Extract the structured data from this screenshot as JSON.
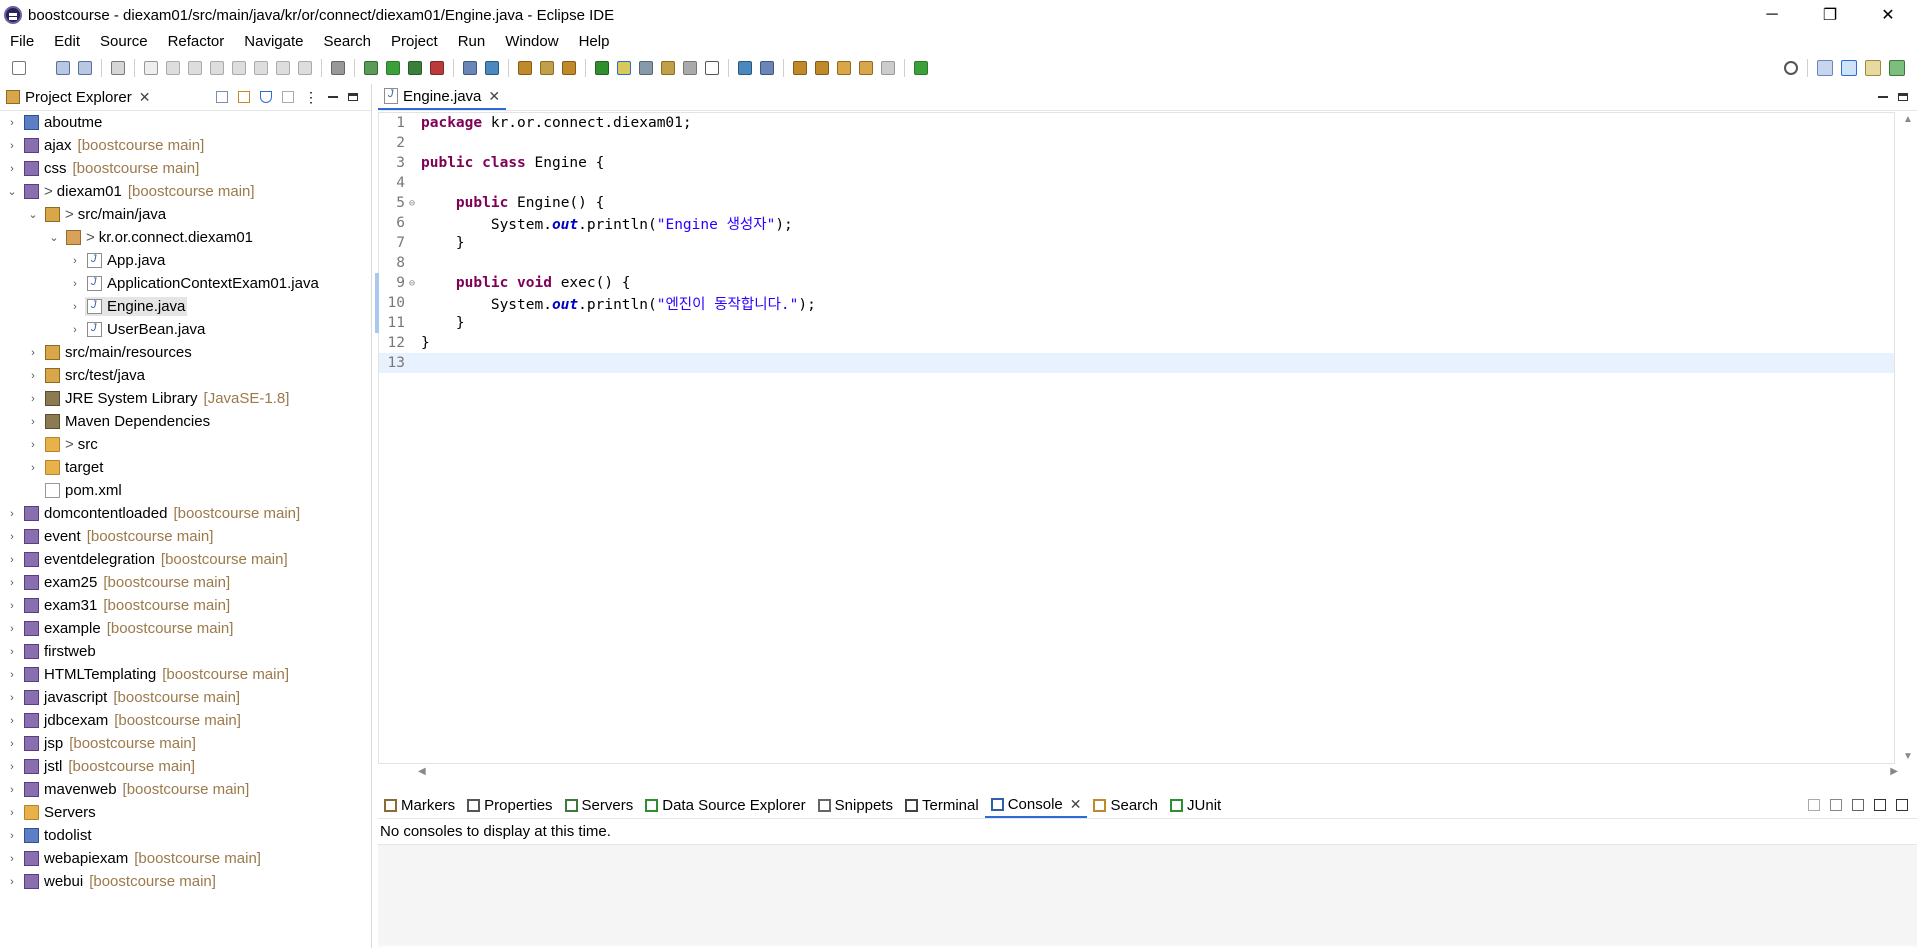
{
  "window": {
    "title": "boostcourse - diexam01/src/main/java/kr/or/connect/diexam01/Engine.java - Eclipse IDE",
    "minimize": "─",
    "restore": "❐",
    "close": "✕"
  },
  "menu": [
    "File",
    "Edit",
    "Source",
    "Refactor",
    "Navigate",
    "Search",
    "Project",
    "Run",
    "Window",
    "Help"
  ],
  "project_explorer": {
    "tab_label": "Project Explorer",
    "close_glyph": "✕",
    "tree": [
      {
        "name": "aboutme",
        "deco": "",
        "twisty": "›",
        "icon": "project",
        "indent": 0
      },
      {
        "name": "ajax",
        "deco": "[boostcourse main]",
        "twisty": "›",
        "icon": "webproj",
        "indent": 0
      },
      {
        "name": "css",
        "deco": "[boostcourse main]",
        "twisty": "›",
        "icon": "webproj",
        "indent": 0
      },
      {
        "name": "diexam01",
        "deco": "[boostcourse main]",
        "twisty": "⌄",
        "icon": "webproj",
        "indent": 0,
        "git": ">"
      },
      {
        "name": "src/main/java",
        "deco": "",
        "twisty": "⌄",
        "icon": "srcfolder",
        "indent": 1,
        "git": ">"
      },
      {
        "name": "kr.or.connect.diexam01",
        "deco": "",
        "twisty": "⌄",
        "icon": "package",
        "indent": 2,
        "git": ">"
      },
      {
        "name": "App.java",
        "deco": "",
        "twisty": "›",
        "icon": "java",
        "indent": 3
      },
      {
        "name": "ApplicationContextExam01.java",
        "deco": "",
        "twisty": "›",
        "icon": "java",
        "indent": 3
      },
      {
        "name": "Engine.java",
        "deco": "",
        "twisty": "›",
        "icon": "java",
        "indent": 3,
        "selected": true
      },
      {
        "name": "UserBean.java",
        "deco": "",
        "twisty": "›",
        "icon": "java",
        "indent": 3
      },
      {
        "name": "src/main/resources",
        "deco": "",
        "twisty": "›",
        "icon": "srcfolder",
        "indent": 1
      },
      {
        "name": "src/test/java",
        "deco": "",
        "twisty": "›",
        "icon": "srcfolder",
        "indent": 1
      },
      {
        "name": "JRE System Library",
        "deco": "[JavaSE-1.8]",
        "twisty": "›",
        "icon": "lib",
        "indent": 1
      },
      {
        "name": "Maven Dependencies",
        "deco": "",
        "twisty": "›",
        "icon": "lib",
        "indent": 1
      },
      {
        "name": "src",
        "deco": "",
        "twisty": "›",
        "icon": "folder",
        "indent": 1,
        "git": ">"
      },
      {
        "name": "target",
        "deco": "",
        "twisty": "›",
        "icon": "folder",
        "indent": 1
      },
      {
        "name": "pom.xml",
        "deco": "",
        "twisty": "",
        "icon": "xml",
        "indent": 1
      },
      {
        "name": "domcontentloaded",
        "deco": "[boostcourse main]",
        "twisty": "›",
        "icon": "webproj",
        "indent": 0
      },
      {
        "name": "event",
        "deco": "[boostcourse main]",
        "twisty": "›",
        "icon": "webproj",
        "indent": 0
      },
      {
        "name": "eventdelegration",
        "deco": "[boostcourse main]",
        "twisty": "›",
        "icon": "webproj",
        "indent": 0
      },
      {
        "name": "exam25",
        "deco": "[boostcourse main]",
        "twisty": "›",
        "icon": "webproj",
        "indent": 0
      },
      {
        "name": "exam31",
        "deco": "[boostcourse main]",
        "twisty": "›",
        "icon": "webproj",
        "indent": 0
      },
      {
        "name": "example",
        "deco": "[boostcourse main]",
        "twisty": "›",
        "icon": "webproj",
        "indent": 0
      },
      {
        "name": "firstweb",
        "deco": "",
        "twisty": "›",
        "icon": "webproj",
        "indent": 0
      },
      {
        "name": "HTMLTemplating",
        "deco": "[boostcourse main]",
        "twisty": "›",
        "icon": "webproj",
        "indent": 0
      },
      {
        "name": "javascript",
        "deco": "[boostcourse main]",
        "twisty": "›",
        "icon": "webproj",
        "indent": 0
      },
      {
        "name": "jdbcexam",
        "deco": "[boostcourse main]",
        "twisty": "›",
        "icon": "webproj",
        "indent": 0
      },
      {
        "name": "jsp",
        "deco": "[boostcourse main]",
        "twisty": "›",
        "icon": "webproj",
        "indent": 0
      },
      {
        "name": "jstl",
        "deco": "[boostcourse main]",
        "twisty": "›",
        "icon": "webproj",
        "indent": 0
      },
      {
        "name": "mavenweb",
        "deco": "[boostcourse main]",
        "twisty": "›",
        "icon": "webproj",
        "indent": 0
      },
      {
        "name": "Servers",
        "deco": "",
        "twisty": "›",
        "icon": "folder",
        "indent": 0
      },
      {
        "name": "todolist",
        "deco": "",
        "twisty": "›",
        "icon": "project",
        "indent": 0
      },
      {
        "name": "webapiexam",
        "deco": "[boostcourse main]",
        "twisty": "›",
        "icon": "webproj",
        "indent": 0
      },
      {
        "name": "webui",
        "deco": "[boostcourse main]",
        "twisty": "›",
        "icon": "webproj",
        "indent": 0
      }
    ]
  },
  "editor": {
    "tab_label": "Engine.java",
    "close_glyph": "✕",
    "current_line": 13,
    "changed_lines": [
      9,
      10,
      11
    ],
    "lines": [
      {
        "n": "1",
        "fold": "",
        "tokens": [
          {
            "t": "package",
            "c": "kw"
          },
          {
            "t": " kr.or.connect.diexam01;",
            "c": ""
          }
        ]
      },
      {
        "n": "2",
        "fold": "",
        "tokens": []
      },
      {
        "n": "3",
        "fold": "",
        "tokens": [
          {
            "t": "public",
            "c": "kw"
          },
          {
            "t": " ",
            "c": ""
          },
          {
            "t": "class",
            "c": "kw"
          },
          {
            "t": " Engine {",
            "c": ""
          }
        ]
      },
      {
        "n": "4",
        "fold": "",
        "tokens": []
      },
      {
        "n": "5",
        "fold": "⊖",
        "tokens": [
          {
            "t": "    ",
            "c": ""
          },
          {
            "t": "public",
            "c": "kw"
          },
          {
            "t": " Engine() {",
            "c": ""
          }
        ]
      },
      {
        "n": "6",
        "fold": "",
        "tokens": [
          {
            "t": "        System.",
            "c": ""
          },
          {
            "t": "out",
            "c": "fld"
          },
          {
            "t": ".println(",
            "c": ""
          },
          {
            "t": "\"Engine 생성자\"",
            "c": "str"
          },
          {
            "t": ");",
            "c": ""
          }
        ]
      },
      {
        "n": "7",
        "fold": "",
        "tokens": [
          {
            "t": "    }",
            "c": ""
          }
        ]
      },
      {
        "n": "8",
        "fold": "",
        "tokens": []
      },
      {
        "n": "9",
        "fold": "⊖",
        "tokens": [
          {
            "t": "    ",
            "c": ""
          },
          {
            "t": "public",
            "c": "kw"
          },
          {
            "t": " ",
            "c": ""
          },
          {
            "t": "void",
            "c": "kw"
          },
          {
            "t": " exec() {",
            "c": ""
          }
        ]
      },
      {
        "n": "10",
        "fold": "",
        "tokens": [
          {
            "t": "        System.",
            "c": ""
          },
          {
            "t": "out",
            "c": "fld"
          },
          {
            "t": ".println(",
            "c": ""
          },
          {
            "t": "\"엔진이 동작합니다.\"",
            "c": "str"
          },
          {
            "t": ");",
            "c": ""
          }
        ]
      },
      {
        "n": "11",
        "fold": "",
        "tokens": [
          {
            "t": "    }",
            "c": ""
          }
        ]
      },
      {
        "n": "12",
        "fold": "",
        "tokens": [
          {
            "t": "}",
            "c": ""
          }
        ]
      },
      {
        "n": "13",
        "fold": "",
        "tokens": []
      }
    ]
  },
  "bottom": {
    "tabs": [
      {
        "label": "Markers",
        "icon": "markers-icon",
        "color": "#8a6a3a"
      },
      {
        "label": "Properties",
        "icon": "properties-icon",
        "color": "#555555"
      },
      {
        "label": "Servers",
        "icon": "servers-icon",
        "color": "#3b7a3b"
      },
      {
        "label": "Data Source Explorer",
        "icon": "data-source-icon",
        "color": "#2f8f2f"
      },
      {
        "label": "Snippets",
        "icon": "snippets-icon",
        "color": "#666666"
      },
      {
        "label": "Terminal",
        "icon": "terminal-icon",
        "color": "#444444"
      },
      {
        "label": "Console",
        "icon": "console-icon",
        "color": "#2f5fa8",
        "active": true
      },
      {
        "label": "Search",
        "icon": "search-icon",
        "color": "#c08a2a"
      },
      {
        "label": "JUnit",
        "icon": "junit-icon",
        "color": "#2f8f2f"
      }
    ],
    "console_message": "No consoles to display at this time.",
    "close_glyph": "✕"
  },
  "colors": {
    "accent": "#2f6bd6",
    "keyword": "#7f0055",
    "string": "#2a00ff",
    "field": "#0000c0",
    "decoration": "#9b7a4b"
  }
}
